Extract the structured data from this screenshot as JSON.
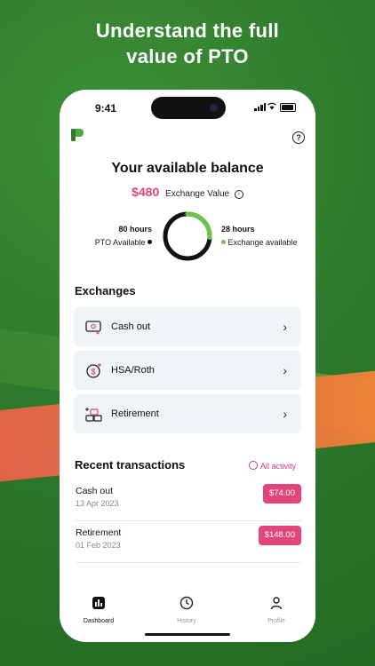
{
  "headline": {
    "line1": "Understand the full",
    "line2": "value of PTO"
  },
  "status_bar": {
    "time": "9:41"
  },
  "balance": {
    "title": "Your available balance",
    "exchange_amount": "$480",
    "exchange_label": "Exchange Value",
    "pto_hours": "80 hours",
    "pto_label": "PTO Available",
    "exchange_hours": "28 hours",
    "exchange_available_label": "Exchange available",
    "exchange_fraction": 0.26,
    "colors": {
      "accent": "#e0457b",
      "green": "#6cc24a",
      "dark": "#111111"
    }
  },
  "exchanges": {
    "heading": "Exchanges",
    "items": [
      {
        "label": "Cash out",
        "icon": "cash-icon"
      },
      {
        "label": "HSA/Roth",
        "icon": "hsa-dollar-icon"
      },
      {
        "label": "Retirement",
        "icon": "retirement-blocks-icon"
      }
    ]
  },
  "transactions": {
    "heading": "Recent transactions",
    "all_activity": "All activity",
    "items": [
      {
        "name": "Cash out",
        "date": "13 Apr 2023",
        "amount": "$74.00"
      },
      {
        "name": "Retirement",
        "date": "01 Feb 2023",
        "amount": "$148.00"
      }
    ]
  },
  "tabs": [
    {
      "label": "Dashboard",
      "icon": "dashboard-icon",
      "active": true
    },
    {
      "label": "History",
      "icon": "history-icon",
      "active": false
    },
    {
      "label": "Profile",
      "icon": "profile-icon",
      "active": false
    }
  ]
}
